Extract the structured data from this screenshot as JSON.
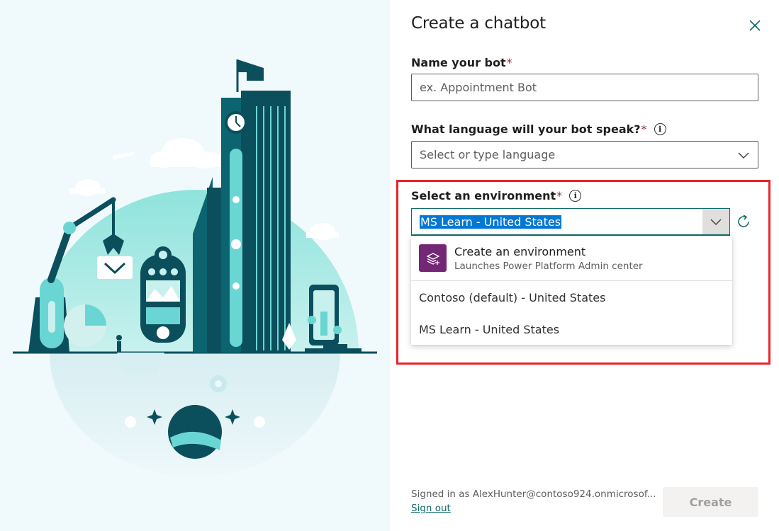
{
  "dialog": {
    "title": "Create a chatbot"
  },
  "name_field": {
    "label": "Name your bot",
    "required_mark": "*",
    "placeholder": "ex. Appointment Bot"
  },
  "language_field": {
    "label": "What language will your bot speak?",
    "required_mark": "*",
    "info_glyph": "i",
    "placeholder": "Select or type language"
  },
  "environment_field": {
    "label": "Select an environment",
    "required_mark": "*",
    "info_glyph": "i",
    "value": "MS Learn - United States",
    "highlight_color": "#e8242a",
    "dropdown": {
      "create_option": {
        "title": "Create an environment",
        "subtitle": "Launches Power Platform Admin center",
        "icon": "power-platform-icon"
      },
      "options": [
        "Contoso (default) - United States",
        "MS Learn - United States"
      ]
    }
  },
  "footer": {
    "signed_in_text": "Signed in as AlexHunter@contoso924.onmicrosof...",
    "sign_out_label": "Sign out",
    "create_label": "Create"
  },
  "colors": {
    "accent": "#0f6b6a",
    "selection": "#0078d4",
    "purple_icon": "#742774",
    "illustration_teal": "#6ad6d3",
    "illustration_dark": "#0b4f5c"
  }
}
